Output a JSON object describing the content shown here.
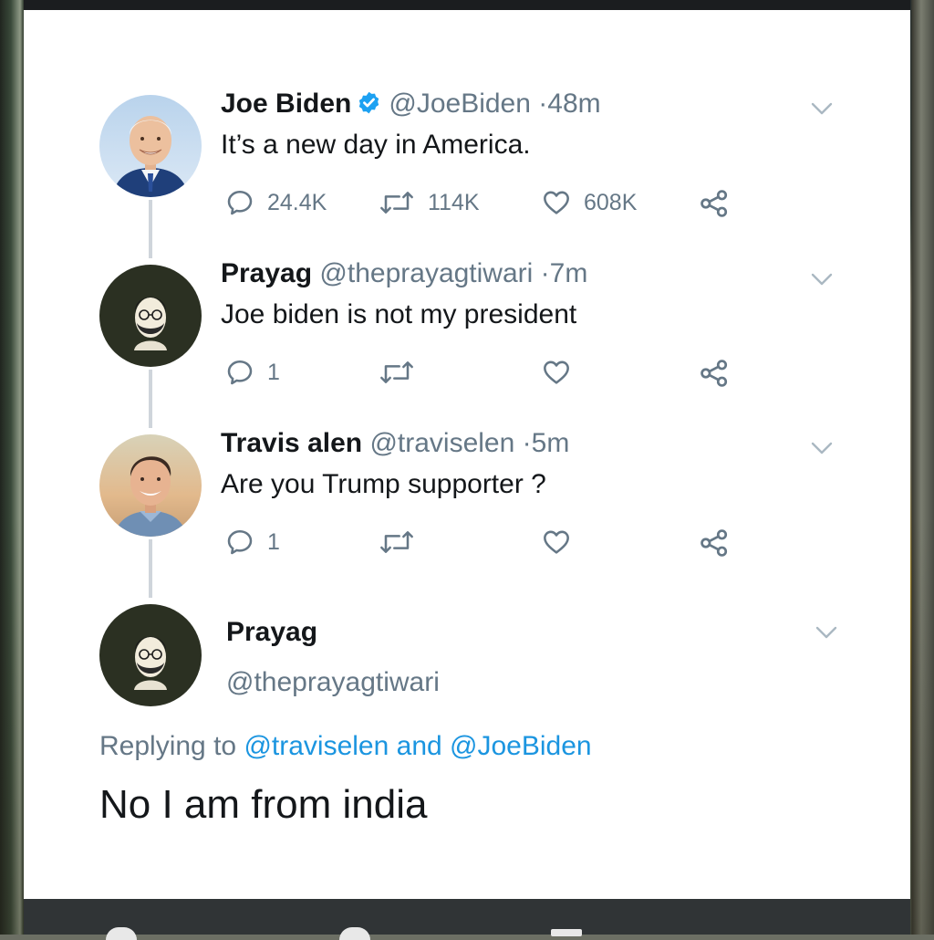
{
  "colors": {
    "accent": "#1DA1F2",
    "text": "#14171A",
    "muted": "#657786",
    "thread": "#CFD5DB"
  },
  "tweets": [
    {
      "name": "Joe Biden",
      "verified": true,
      "handle": "@JoeBiden",
      "sep": "·",
      "time": "48m",
      "text": "It’s a new day in America.",
      "replies": "24.4K",
      "retweets": "114K",
      "likes": "608K",
      "icons": [
        "reply-icon",
        "retweet-icon",
        "like-icon",
        "share-icon"
      ]
    },
    {
      "name": "Prayag",
      "verified": false,
      "handle": "@theprayagtiwari",
      "sep": "·",
      "time": "7m",
      "text": "Joe biden is not my president",
      "replies": "1",
      "retweets": "",
      "likes": ""
    },
    {
      "name": "Travis alen",
      "verified": false,
      "handle": "@traviselen",
      "sep": "·",
      "time": "5m",
      "text": "Are you Trump supporter ?",
      "replies": "1",
      "retweets": "",
      "likes": ""
    }
  ],
  "focused_reply": {
    "name": "Prayag",
    "handle": "@theprayagtiwari",
    "replying_prefix": "Replying to",
    "mention_1": "@traviselen",
    "mention_joiner": "and",
    "mention_2": "@JoeBiden",
    "text": "No I am from india"
  }
}
